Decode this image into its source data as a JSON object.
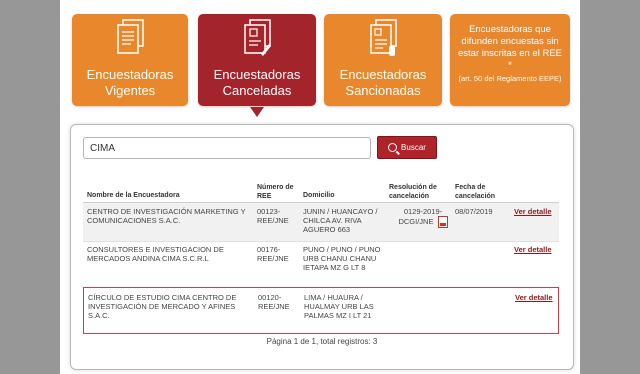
{
  "tabs": [
    {
      "label": "Encuestadoras Vigentes"
    },
    {
      "label": "Encuestadoras Canceladas"
    },
    {
      "label": "Encuestadoras Sancionadas"
    }
  ],
  "notice_card": {
    "text": "Encuestadoras que difunden encuestas sin estar inscritas en el REE *",
    "note": "(art. 50 del Reglamento EEPE)"
  },
  "search": {
    "value": "CIMA",
    "button_label": "Buscar"
  },
  "table": {
    "headers": {
      "name": "Nombre de la Encuestadora",
      "ree": "Número de REE",
      "domicilio": "Domicilio",
      "resolucion": "Resolución de cancelación",
      "fecha": "Fecha de cancelación"
    },
    "rows": [
      {
        "name": "CENTRO DE INVESTIGACIÓN MARKETING Y COMUNICACIONES S.A.C.",
        "ree": "00123-REE/JNE",
        "domicilio": "JUNIN / HUANCAYO / CHILCA AV. RIVA AGUERO 663",
        "resolucion": "0129-2019-DCGI/JNE",
        "fecha": "08/07/2019",
        "link": "Ver detalle"
      },
      {
        "name": "CONSULTORES E INVESTIGACION DE MERCADOS ANDINA CIMA S.C.R.L",
        "ree": "00176-REE/JNE",
        "domicilio": "PUNO / PUNO / PUNO URB CHANU CHANU IETAPA MZ G LT 8",
        "resolucion": "",
        "fecha": "",
        "link": "Ver detalle"
      },
      {
        "name": "CÍRCULO DE ESTUDIO CIMA CENTRO DE INVESTIGACIÓN DE MERCADO Y AFINES S.A.C.",
        "ree": "00120-REE/JNE",
        "domicilio": "LIMA / HUAURA / HUALMAY URB LAS PALMAS MZ I LT 21",
        "resolucion": "",
        "fecha": "",
        "link": "Ver detalle"
      }
    ]
  },
  "pagination": "Página 1 de 1, total registros: 3",
  "colors": {
    "orange": "#e8872c",
    "active_red": "#a3242a",
    "button_red": "#b0232a",
    "highlight": "#c8424a"
  },
  "icons": [
    "document-icon",
    "document-pen-icon",
    "document-dollar-icon",
    "search-icon",
    "pdf-icon"
  ]
}
